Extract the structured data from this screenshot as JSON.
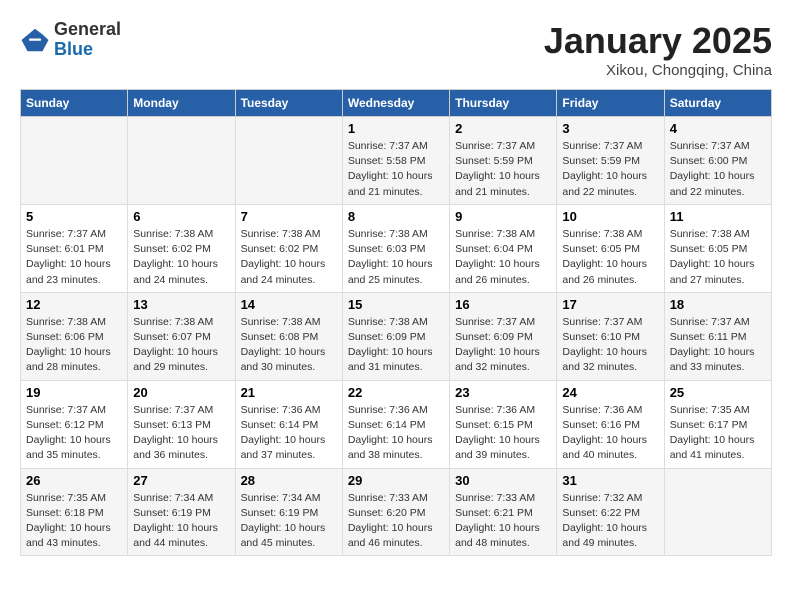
{
  "header": {
    "logo": {
      "general": "General",
      "blue": "Blue"
    },
    "title": "January 2025",
    "subtitle": "Xikou, Chongqing, China"
  },
  "weekdays": [
    "Sunday",
    "Monday",
    "Tuesday",
    "Wednesday",
    "Thursday",
    "Friday",
    "Saturday"
  ],
  "weeks": [
    [
      {
        "num": "",
        "info": ""
      },
      {
        "num": "",
        "info": ""
      },
      {
        "num": "",
        "info": ""
      },
      {
        "num": "1",
        "info": "Sunrise: 7:37 AM\nSunset: 5:58 PM\nDaylight: 10 hours\nand 21 minutes."
      },
      {
        "num": "2",
        "info": "Sunrise: 7:37 AM\nSunset: 5:59 PM\nDaylight: 10 hours\nand 21 minutes."
      },
      {
        "num": "3",
        "info": "Sunrise: 7:37 AM\nSunset: 5:59 PM\nDaylight: 10 hours\nand 22 minutes."
      },
      {
        "num": "4",
        "info": "Sunrise: 7:37 AM\nSunset: 6:00 PM\nDaylight: 10 hours\nand 22 minutes."
      }
    ],
    [
      {
        "num": "5",
        "info": "Sunrise: 7:37 AM\nSunset: 6:01 PM\nDaylight: 10 hours\nand 23 minutes."
      },
      {
        "num": "6",
        "info": "Sunrise: 7:38 AM\nSunset: 6:02 PM\nDaylight: 10 hours\nand 24 minutes."
      },
      {
        "num": "7",
        "info": "Sunrise: 7:38 AM\nSunset: 6:02 PM\nDaylight: 10 hours\nand 24 minutes."
      },
      {
        "num": "8",
        "info": "Sunrise: 7:38 AM\nSunset: 6:03 PM\nDaylight: 10 hours\nand 25 minutes."
      },
      {
        "num": "9",
        "info": "Sunrise: 7:38 AM\nSunset: 6:04 PM\nDaylight: 10 hours\nand 26 minutes."
      },
      {
        "num": "10",
        "info": "Sunrise: 7:38 AM\nSunset: 6:05 PM\nDaylight: 10 hours\nand 26 minutes."
      },
      {
        "num": "11",
        "info": "Sunrise: 7:38 AM\nSunset: 6:05 PM\nDaylight: 10 hours\nand 27 minutes."
      }
    ],
    [
      {
        "num": "12",
        "info": "Sunrise: 7:38 AM\nSunset: 6:06 PM\nDaylight: 10 hours\nand 28 minutes."
      },
      {
        "num": "13",
        "info": "Sunrise: 7:38 AM\nSunset: 6:07 PM\nDaylight: 10 hours\nand 29 minutes."
      },
      {
        "num": "14",
        "info": "Sunrise: 7:38 AM\nSunset: 6:08 PM\nDaylight: 10 hours\nand 30 minutes."
      },
      {
        "num": "15",
        "info": "Sunrise: 7:38 AM\nSunset: 6:09 PM\nDaylight: 10 hours\nand 31 minutes."
      },
      {
        "num": "16",
        "info": "Sunrise: 7:37 AM\nSunset: 6:09 PM\nDaylight: 10 hours\nand 32 minutes."
      },
      {
        "num": "17",
        "info": "Sunrise: 7:37 AM\nSunset: 6:10 PM\nDaylight: 10 hours\nand 32 minutes."
      },
      {
        "num": "18",
        "info": "Sunrise: 7:37 AM\nSunset: 6:11 PM\nDaylight: 10 hours\nand 33 minutes."
      }
    ],
    [
      {
        "num": "19",
        "info": "Sunrise: 7:37 AM\nSunset: 6:12 PM\nDaylight: 10 hours\nand 35 minutes."
      },
      {
        "num": "20",
        "info": "Sunrise: 7:37 AM\nSunset: 6:13 PM\nDaylight: 10 hours\nand 36 minutes."
      },
      {
        "num": "21",
        "info": "Sunrise: 7:36 AM\nSunset: 6:14 PM\nDaylight: 10 hours\nand 37 minutes."
      },
      {
        "num": "22",
        "info": "Sunrise: 7:36 AM\nSunset: 6:14 PM\nDaylight: 10 hours\nand 38 minutes."
      },
      {
        "num": "23",
        "info": "Sunrise: 7:36 AM\nSunset: 6:15 PM\nDaylight: 10 hours\nand 39 minutes."
      },
      {
        "num": "24",
        "info": "Sunrise: 7:36 AM\nSunset: 6:16 PM\nDaylight: 10 hours\nand 40 minutes."
      },
      {
        "num": "25",
        "info": "Sunrise: 7:35 AM\nSunset: 6:17 PM\nDaylight: 10 hours\nand 41 minutes."
      }
    ],
    [
      {
        "num": "26",
        "info": "Sunrise: 7:35 AM\nSunset: 6:18 PM\nDaylight: 10 hours\nand 43 minutes."
      },
      {
        "num": "27",
        "info": "Sunrise: 7:34 AM\nSunset: 6:19 PM\nDaylight: 10 hours\nand 44 minutes."
      },
      {
        "num": "28",
        "info": "Sunrise: 7:34 AM\nSunset: 6:19 PM\nDaylight: 10 hours\nand 45 minutes."
      },
      {
        "num": "29",
        "info": "Sunrise: 7:33 AM\nSunset: 6:20 PM\nDaylight: 10 hours\nand 46 minutes."
      },
      {
        "num": "30",
        "info": "Sunrise: 7:33 AM\nSunset: 6:21 PM\nDaylight: 10 hours\nand 48 minutes."
      },
      {
        "num": "31",
        "info": "Sunrise: 7:32 AM\nSunset: 6:22 PM\nDaylight: 10 hours\nand 49 minutes."
      },
      {
        "num": "",
        "info": ""
      }
    ]
  ]
}
